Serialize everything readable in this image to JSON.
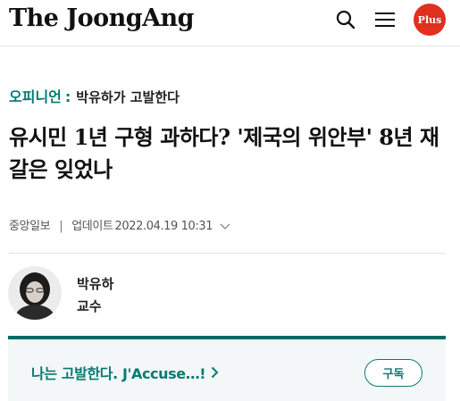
{
  "header": {
    "logo_text": "The JoongAng",
    "search_icon": "search-icon",
    "menu_icon": "hamburger-menu-icon",
    "plus_label": "Plus"
  },
  "article": {
    "series_category": "오피니언",
    "series_colon": ":",
    "series_name": "박유하가 고발한다",
    "headline": "유시민 1년 구형 과하다? '제국의 위안부' 8년 재갈은 잊었나",
    "source": "중앙일보",
    "separator": "|",
    "updated_label": "업데이트",
    "updated_at": "2022.04.19 10:31"
  },
  "author": {
    "name": "박유하",
    "role": "교수"
  },
  "series_banner": {
    "link_text": "나는 고발한다. J'Accuse…!",
    "subscribe_label": "구독"
  },
  "colors": {
    "brand_red": "#e0301e",
    "series_teal": "#007a74",
    "banner_border": "#006c66",
    "banner_bg": "#f3f7f7"
  }
}
